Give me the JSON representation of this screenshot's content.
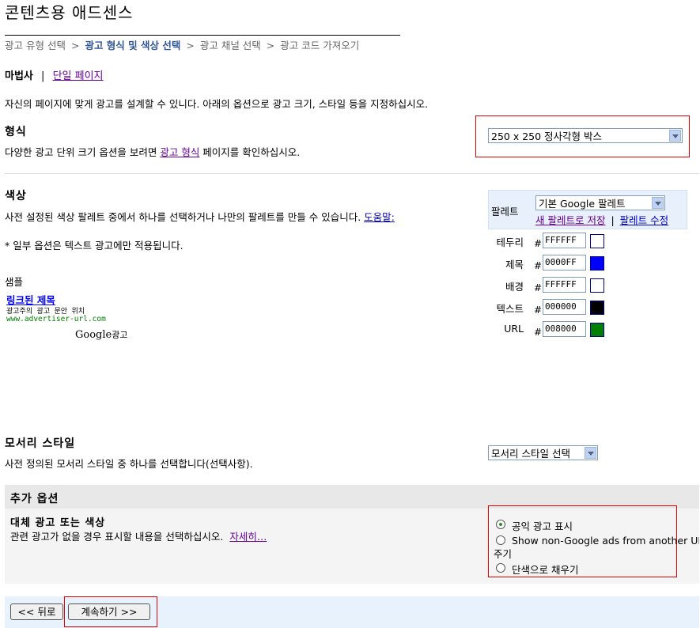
{
  "page": {
    "title": "콘텐츠용 애드센스"
  },
  "wizard": {
    "steps": [
      "광고 유형 선택",
      "광고 형식 및 색상 선택",
      "광고 채널 선택",
      "광고 코드 가져오기"
    ],
    "separator": ">",
    "current_step": 2
  },
  "mode": {
    "wizard_label": "마법사",
    "divider": "|",
    "single_page_link": "단일 페이지"
  },
  "intro": "자신의 페이지에 맞게 광고를 설계할 수 있니다. 아래의 옵션으로 광고 크기, 스타일 등을 지정하십시오.",
  "format": {
    "heading": "형식",
    "desc_before": "다양한 광고 단위 크기 옵션을 보려면 ",
    "desc_link": "광고 형식",
    "desc_after": " 페이지를 확인하십시오.",
    "selected": "250 x 250 정사각형 박스"
  },
  "colors": {
    "heading": "색상",
    "desc": "사전 설정된 색상 팔레트 중에서 하나를 선택하거나 나만의 팔레트를 만들 수 있습니다.",
    "help_link": "도움말:",
    "note": "* 일부 옵션은 텍스트 광고에만 적용됩니다.",
    "sample_label": "샘플",
    "palette_label": "팔레트",
    "palette_selected": "기본 Google 팔레트",
    "save_new_link": "새 팔레트로 저장",
    "links_divider": "|",
    "edit_link": "팔레트 수정",
    "hash": "#",
    "rows": [
      {
        "label": "테두리",
        "value": "FFFFFF",
        "color": "#FFFFFF"
      },
      {
        "label": "제목",
        "value": "0000FF",
        "color": "#0000FF"
      },
      {
        "label": "배경",
        "value": "FFFFFF",
        "color": "#FFFFFF"
      },
      {
        "label": "텍스트",
        "value": "000000",
        "color": "#000000"
      },
      {
        "label": "URL",
        "value": "008000",
        "color": "#008000"
      }
    ]
  },
  "sample_ad": {
    "title": "링크된 제목",
    "body": "광고주의 광고 문안 위치",
    "url": "www.advertiser-url.com",
    "attribution_brand": "Google",
    "attribution_suffix": "광고"
  },
  "corner": {
    "heading": "모서리 스타일",
    "desc": "사전 정의된 모서리 스타일 중 하나를 선택합니다(선택사항).",
    "selected": "모서리 스타일 선택"
  },
  "extra": {
    "bar_title": "추가 옵션",
    "heading": "대체 광고 또는 색상",
    "desc": "관련 광고가 없을 경우 표시할 내용을 선택하십시오.",
    "more_link": "자세히…",
    "options": [
      {
        "label": "공익 광고 표시",
        "checked": true
      },
      {
        "label": "Show non-Google ads from another URL",
        "checked": false
      },
      {
        "label": "단색으로 채우기",
        "checked": false
      }
    ],
    "wrap_text": "주기"
  },
  "buttons": {
    "back": "<< 뒤로",
    "next": "계속하기 >>"
  }
}
